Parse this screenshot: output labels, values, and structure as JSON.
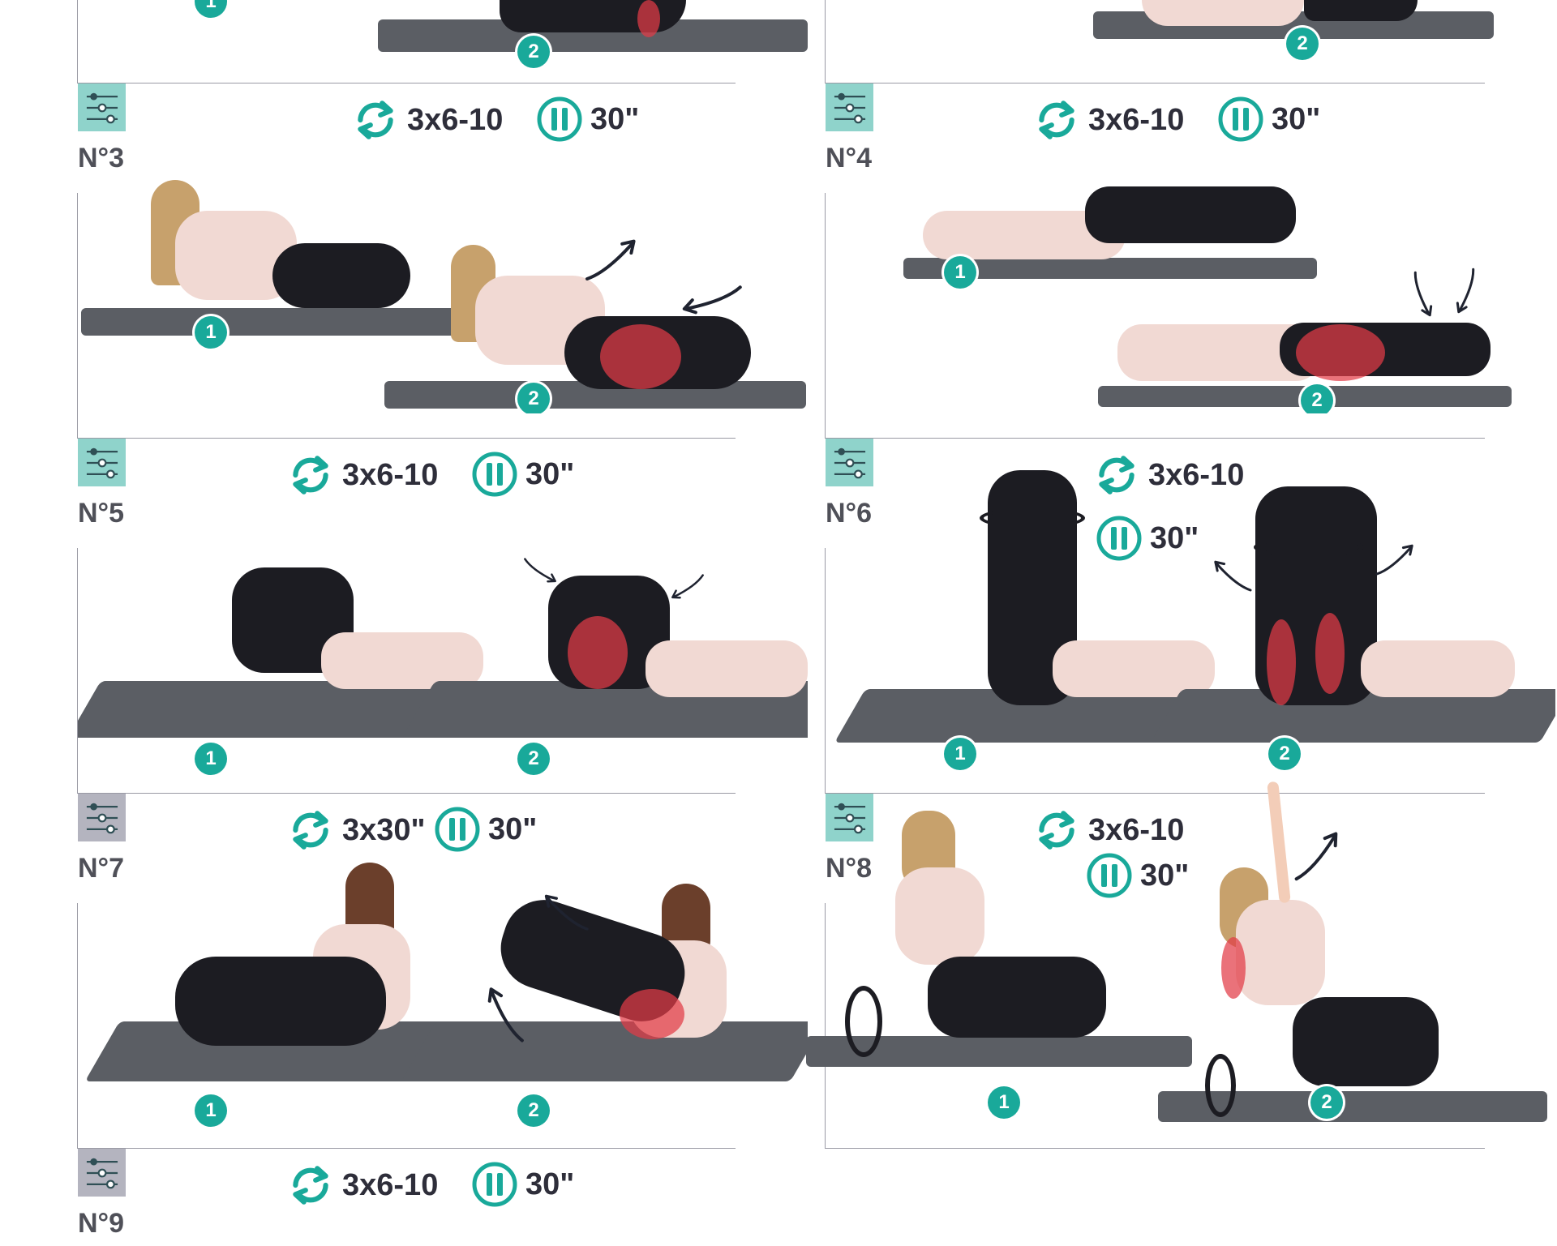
{
  "exercises": [
    {
      "number": "N°3",
      "reps": "3x6-10",
      "rest": "30\"",
      "level": "teal",
      "step1": "1",
      "step2": "2"
    },
    {
      "number": "N°4",
      "reps": "3x6-10",
      "rest": "30\"",
      "level": "teal",
      "step1": "1",
      "step2": "2"
    },
    {
      "number": "N°5",
      "reps": "3x6-10",
      "rest": "30\"",
      "level": "teal",
      "step1": "1",
      "step2": "2"
    },
    {
      "number": "N°6",
      "reps": "3x6-10",
      "rest": "30\"",
      "level": "teal",
      "step1": "1",
      "step2": "2"
    },
    {
      "number": "N°7",
      "reps": "3x30\"",
      "rest": "30\"",
      "level": "grey",
      "step1": "1",
      "step2": "2"
    },
    {
      "number": "N°8",
      "reps": "3x6-10",
      "rest": "30\"",
      "level": "teal",
      "step1": "1",
      "step2": "2"
    },
    {
      "number": "N°9",
      "reps": "3x6-10",
      "rest": "30\"",
      "level": "grey"
    }
  ],
  "top_partial": {
    "left_step": "1",
    "left_step2": "2",
    "right_step2": "2"
  },
  "colors": {
    "accent": "#19a99a",
    "level_teal": "#8fd3cb",
    "level_grey": "#b4b4bf",
    "mat": "#5b5e64",
    "muscle": "#e23c46",
    "text": "#2e2e3a"
  },
  "icons": {
    "reps": "repeat-icon",
    "rest": "pause-icon",
    "level": "sliders-icon"
  }
}
